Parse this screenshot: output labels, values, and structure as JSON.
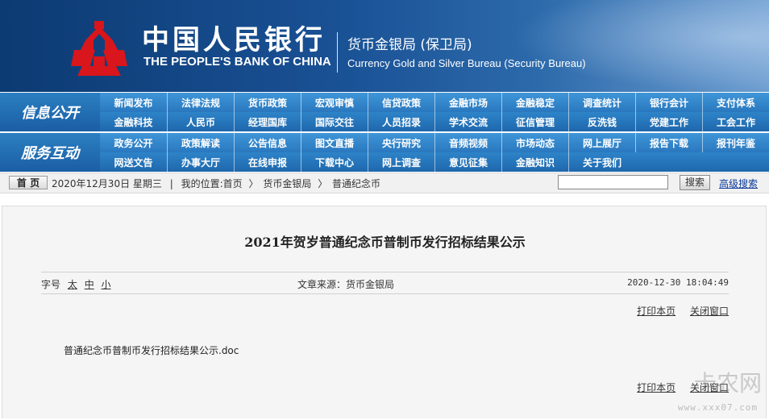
{
  "header": {
    "bank_name_cn": "中国人民银行",
    "bank_name_en": "THE PEOPLE'S BANK OF CHINA",
    "bureau_cn": "货币金银局 (保卫局)",
    "bureau_en": "Currency  Gold and Silver Bureau (Security Bureau)",
    "logo_icon": "pboc-logo-icon"
  },
  "nav": {
    "info_label": "信息公开",
    "interact_label": "服务互动",
    "info_row1": [
      "新闻发布",
      "法律法规",
      "货币政策",
      "宏观审慎",
      "信贷政策",
      "金融市场",
      "金融稳定",
      "调查统计",
      "银行会计",
      "支付体系"
    ],
    "info_row2": [
      "金融科技",
      "人民币",
      "经理国库",
      "国际交往",
      "人员招录",
      "学术交流",
      "征信管理",
      "反洗钱",
      "党建工作",
      "工会工作"
    ],
    "inter_row1": [
      "政务公开",
      "政策解读",
      "公告信息",
      "图文直播",
      "央行研究",
      "音频视频",
      "市场动态",
      "网上展厅",
      "报告下载",
      "报刊年鉴"
    ],
    "inter_row2": [
      "网送文告",
      "办事大厅",
      "在线申报",
      "下载中心",
      "网上调查",
      "意见征集",
      "金融知识",
      "关于我们"
    ]
  },
  "breadcrumb": {
    "home_button": "首 页",
    "date": "2020年12月30日 星期三",
    "divider": "|",
    "location_label": "我的位置:",
    "path": [
      "首页",
      "货币金银局",
      "普通纪念币"
    ],
    "arrow": "〉",
    "search_button": "搜索",
    "search_value": "",
    "advanced_search": "高级搜索"
  },
  "article": {
    "title": "2021年贺岁普通纪念币普制币发行招标结果公示",
    "font_size_label": "字号",
    "font_sizes": [
      "太",
      "中",
      "小"
    ],
    "source": "文章来源：货币金银局",
    "datetime": "2020-12-30 18:04:49",
    "print_link": "打印本页",
    "close_link": "关闭窗口",
    "attachment": "普通纪念币普制币发行招标结果公示.doc"
  },
  "watermark": {
    "glyph": "卡农网",
    "url": "www.xxx07.com"
  }
}
